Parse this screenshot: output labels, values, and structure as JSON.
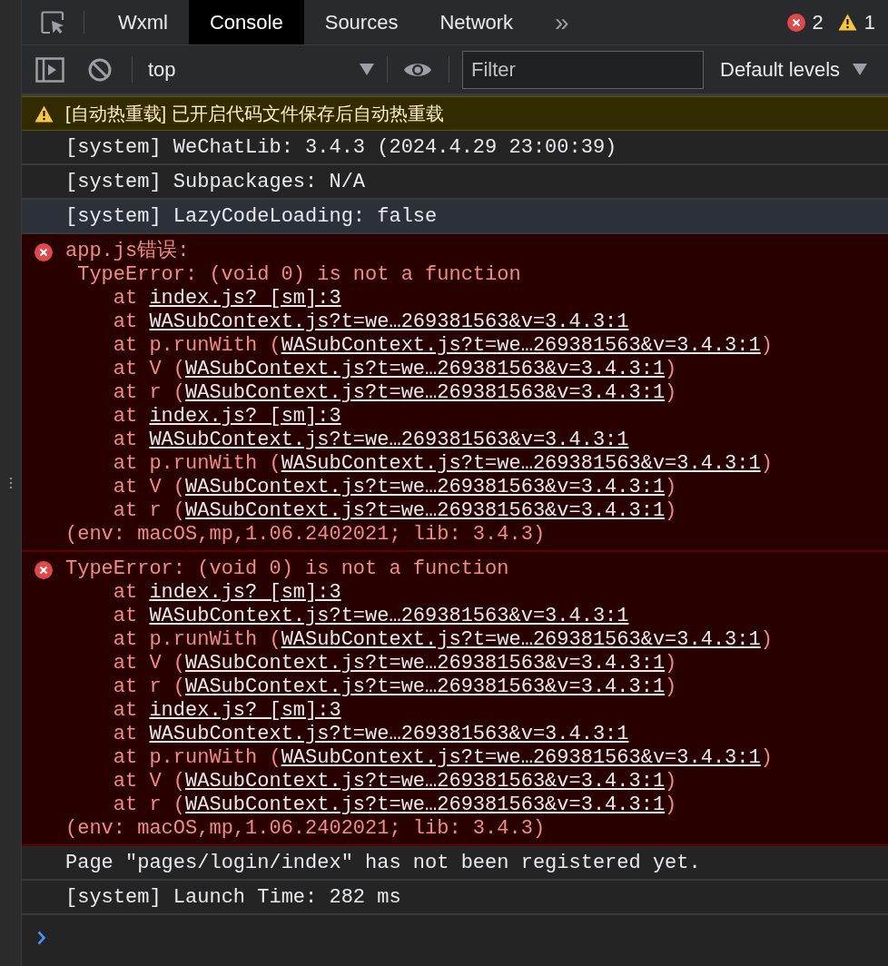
{
  "tabs": [
    {
      "label": "Wxml",
      "selected": false
    },
    {
      "label": "Console",
      "selected": true
    },
    {
      "label": "Sources",
      "selected": false
    },
    {
      "label": "Network",
      "selected": false
    }
  ],
  "more_tabs": "»",
  "counts": {
    "errors": "2",
    "warnings": "1"
  },
  "toolbar": {
    "context": "top",
    "filter": {
      "placeholder": "Filter"
    },
    "levels": "Default levels"
  },
  "messages": [
    {
      "kind": "warning",
      "text": "[自动热重载] 已开启代码文件保存后自动热重载"
    },
    {
      "kind": "log",
      "text": "[system] WeChatLib: 3.4.3 (2024.4.29 23:00:39)",
      "highlighted": false
    },
    {
      "kind": "log",
      "text": "[system] Subpackages: N/A",
      "highlighted": false
    },
    {
      "kind": "log",
      "text": "[system] LazyCodeLoading: false",
      "highlighted": true
    },
    {
      "kind": "error",
      "lines": [
        {
          "kind": "head",
          "text": "app.js错误:"
        },
        {
          "kind": "detail",
          "text": "TypeError: (void 0) is not a function"
        },
        {
          "kind": "frame",
          "before": "at",
          "link": "index.js? [sm]:3"
        },
        {
          "kind": "frame",
          "before": "at",
          "link": "WASubContext.js?t=we…269381563&v=3.4.3:1"
        },
        {
          "kind": "frame",
          "before": "at p.runWith (",
          "link": "WASubContext.js?t=we…269381563&v=3.4.3:1",
          "after": ")"
        },
        {
          "kind": "frame",
          "before": "at V (",
          "link": "WASubContext.js?t=we…269381563&v=3.4.3:1",
          "after": ")"
        },
        {
          "kind": "frame",
          "before": "at r (",
          "link": "WASubContext.js?t=we…269381563&v=3.4.3:1",
          "after": ")"
        },
        {
          "kind": "frame",
          "before": "at",
          "link": "index.js? [sm]:3"
        },
        {
          "kind": "frame",
          "before": "at",
          "link": "WASubContext.js?t=we…269381563&v=3.4.3:1"
        },
        {
          "kind": "frame",
          "before": "at p.runWith (",
          "link": "WASubContext.js?t=we…269381563&v=3.4.3:1",
          "after": ")"
        },
        {
          "kind": "frame",
          "before": "at V (",
          "link": "WASubContext.js?t=we…269381563&v=3.4.3:1",
          "after": ")"
        },
        {
          "kind": "frame",
          "before": "at r (",
          "link": "WASubContext.js?t=we…269381563&v=3.4.3:1",
          "after": ")"
        },
        {
          "kind": "env",
          "text": "(env: macOS,mp,1.06.2402021; lib: 3.4.3)"
        }
      ]
    },
    {
      "kind": "error",
      "lines": [
        {
          "kind": "head",
          "text": "TypeError: (void 0) is not a function"
        },
        {
          "kind": "frame",
          "before": "at",
          "link": "index.js? [sm]:3"
        },
        {
          "kind": "frame",
          "before": "at",
          "link": "WASubContext.js?t=we…269381563&v=3.4.3:1"
        },
        {
          "kind": "frame",
          "before": "at p.runWith (",
          "link": "WASubContext.js?t=we…269381563&v=3.4.3:1",
          "after": ")"
        },
        {
          "kind": "frame",
          "before": "at V (",
          "link": "WASubContext.js?t=we…269381563&v=3.4.3:1",
          "after": ")"
        },
        {
          "kind": "frame",
          "before": "at r (",
          "link": "WASubContext.js?t=we…269381563&v=3.4.3:1",
          "after": ")"
        },
        {
          "kind": "frame",
          "before": "at",
          "link": "index.js? [sm]:3"
        },
        {
          "kind": "frame",
          "before": "at",
          "link": "WASubContext.js?t=we…269381563&v=3.4.3:1"
        },
        {
          "kind": "frame",
          "before": "at p.runWith (",
          "link": "WASubContext.js?t=we…269381563&v=3.4.3:1",
          "after": ")"
        },
        {
          "kind": "frame",
          "before": "at V (",
          "link": "WASubContext.js?t=we…269381563&v=3.4.3:1",
          "after": ")"
        },
        {
          "kind": "frame",
          "before": "at r (",
          "link": "WASubContext.js?t=we…269381563&v=3.4.3:1",
          "after": ")"
        },
        {
          "kind": "env",
          "text": "(env: macOS,mp,1.06.2402021; lib: 3.4.3)"
        }
      ]
    },
    {
      "kind": "log",
      "text": "Page \"pages/login/index\" has not been registered yet.",
      "highlighted": false
    },
    {
      "kind": "log",
      "text": "[system] Launch Time: 282 ms",
      "highlighted": false
    }
  ]
}
